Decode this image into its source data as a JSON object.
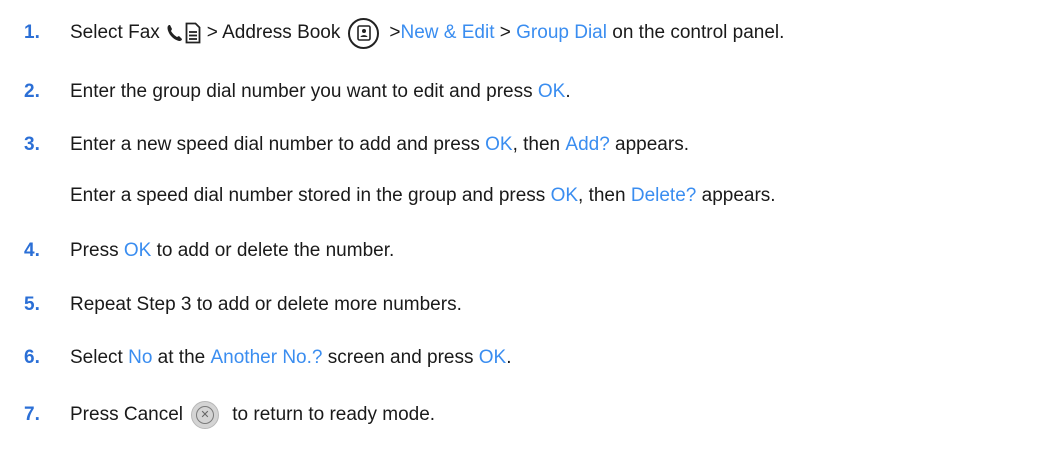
{
  "steps": [
    {
      "number": "1.",
      "parts": [
        "Select Fax",
        "> Address Book",
        "> ",
        "New & Edit",
        " > ",
        "Group Dial",
        " on the control panel."
      ]
    },
    {
      "number": "2.",
      "parts": [
        "Enter the group dial number you want to edit and press ",
        "OK",
        "."
      ]
    },
    {
      "number": "3.",
      "parts": [
        "Enter a new speed dial number to add and press ",
        "OK",
        ", then ",
        "Add?",
        " appears."
      ]
    },
    {
      "number": "",
      "parts": [
        "Enter a speed dial number stored in the group and press ",
        "OK",
        ", then ",
        "Delete?",
        " appears."
      ]
    },
    {
      "number": "4.",
      "parts": [
        "Press ",
        "OK",
        " to add or delete the number."
      ]
    },
    {
      "number": "5.",
      "parts": [
        "Repeat Step 3 to add or delete more numbers."
      ]
    },
    {
      "number": "6.",
      "parts": [
        "Select ",
        "No",
        " at the ",
        "Another No.?",
        " screen and press ",
        "OK",
        "."
      ]
    },
    {
      "number": "7.",
      "parts": [
        "Press Cancel",
        " to return to ready mode."
      ]
    }
  ],
  "icons": [
    "fax-phone-icon",
    "document-icon",
    "address-book-icon",
    "cancel-icon"
  ],
  "colors": {
    "step_number": "#2b6fd6",
    "highlight": "#3a8df0",
    "text": "#1a1a1a"
  }
}
